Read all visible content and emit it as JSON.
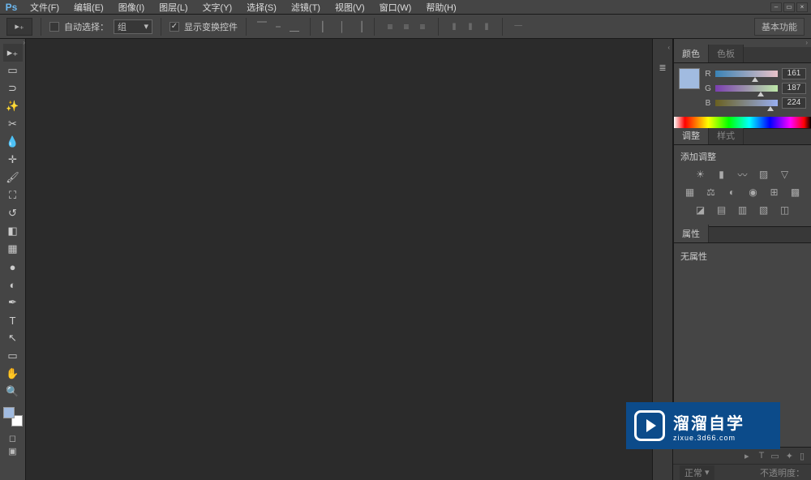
{
  "app": {
    "logo": "Ps"
  },
  "menu": [
    {
      "label": "文件(F)"
    },
    {
      "label": "编辑(E)"
    },
    {
      "label": "图像(I)"
    },
    {
      "label": "图层(L)"
    },
    {
      "label": "文字(Y)"
    },
    {
      "label": "选择(S)"
    },
    {
      "label": "滤镜(T)"
    },
    {
      "label": "视图(V)"
    },
    {
      "label": "窗口(W)"
    },
    {
      "label": "帮助(H)"
    }
  ],
  "options": {
    "auto_select_label": "自动选择：",
    "group_value": "组",
    "show_transform_label": "显示变换控件",
    "workspace_label": "基本功能"
  },
  "color_panel": {
    "tab_color": "颜色",
    "tab_swatches": "色板",
    "r_label": "R",
    "r_value": "161",
    "g_label": "G",
    "g_value": "187",
    "b_label": "B",
    "b_value": "224",
    "preview_hex": "#a1bbe0"
  },
  "adjust_panel": {
    "tab_adjust": "调整",
    "tab_styles": "样式",
    "title": "添加调整"
  },
  "props_panel": {
    "tab_properties": "属性",
    "empty_text": "无属性"
  },
  "layers_panel": {
    "blend_mode": "正常",
    "opacity_label": "不透明度："
  },
  "watermark": {
    "main": "溜溜自学",
    "sub": "zixue.3d66.com"
  }
}
